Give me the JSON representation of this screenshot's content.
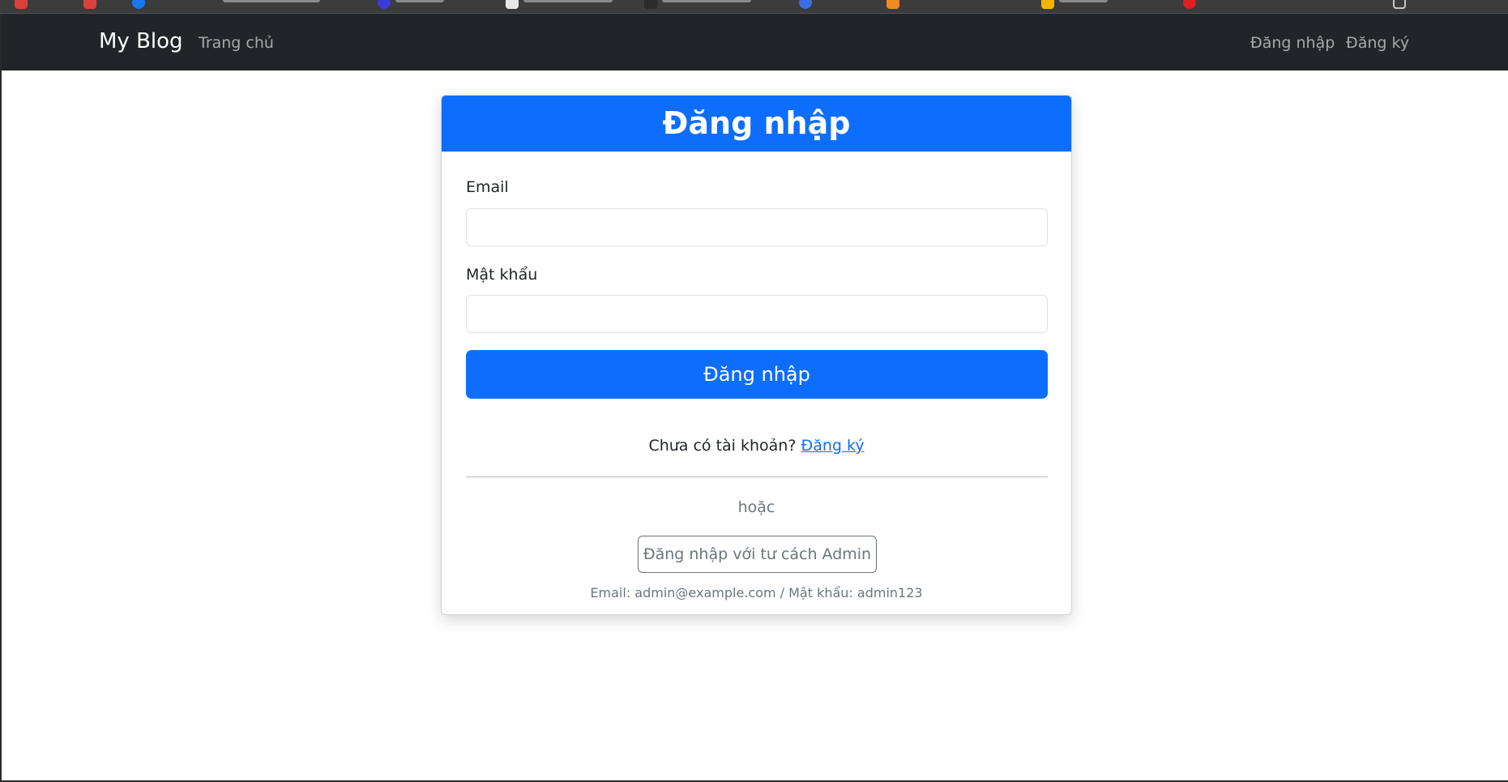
{
  "navbar": {
    "brand": "My Blog",
    "home": "Trang chủ",
    "login": "Đăng nhập",
    "register": "Đăng ký"
  },
  "login_card": {
    "title": "Đăng nhập",
    "email_label": "Email",
    "email_value": "",
    "password_label": "Mật khẩu",
    "password_value": "",
    "submit_label": "Đăng nhập",
    "no_account_text": "Chưa có tài khoản?",
    "register_link": "Đăng ký",
    "or_text": "hoặc",
    "admin_button": "Đăng nhập với tư cách Admin",
    "admin_hint": "Email: admin@example.com / Mật khẩu: admin123"
  },
  "colors": {
    "navbar_bg": "#212529",
    "primary": "#0d6efd",
    "secondary": "#6c757d"
  }
}
